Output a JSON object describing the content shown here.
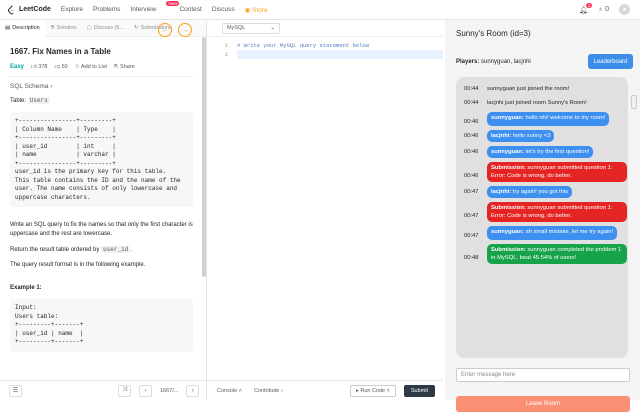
{
  "nav": {
    "brand": "LeetCode",
    "links": [
      "Explore",
      "Problems",
      "Interview",
      "Contest",
      "Discuss"
    ],
    "new_badge": "New",
    "store": "Store",
    "notif_count": "1",
    "coins": "0"
  },
  "left_tabs": [
    "Description",
    "Solution",
    "Discuss (5...",
    "Submissions"
  ],
  "problem": {
    "title": "1667. Fix Names in a Table",
    "difficulty": "Easy",
    "likes": "378",
    "dislikes": "60",
    "add_to_list": "Add to List",
    "share": "Share",
    "schema": "SQL Schema",
    "table_label": "Table:",
    "table_name": "Users",
    "schema_block": "+----------------+---------+\n| Column Name    | Type    |\n+----------------+---------+\n| user_id        | int     |\n| name           | varchar |\n+----------------+---------+\nuser_id is the primary key for this table.\nThis table contains the ID and the name of the\nuser. The name consists of only lowercase and\nuppercase characters.",
    "para1": "Write an SQL query to fix the names so that only the first character is uppercase and the rest are lowercase.",
    "para2_prefix": "Return the result table ordered by",
    "para2_code": "user_id",
    "para3": "The query result format is in the following example.",
    "example_title": "Example 1:",
    "example_block": "Input:\nUsers table:\n+---------+-------+\n| user_id | name  |\n+---------+-------+"
  },
  "bottom_left": {
    "page": "1667/..."
  },
  "editor": {
    "language": "MySQL",
    "lines": [
      "1",
      "2"
    ],
    "code_line1": "# Write your MySQL query statement below",
    "console": "Console",
    "contribute": "Contribute",
    "run": "Run Code",
    "submit": "Submit"
  },
  "room": {
    "title": "Sunny's Room (id=3)",
    "players_label": "Players:",
    "players": "sunnyguan, lacjnhi",
    "leaderboard": "Leaderboard",
    "messages": [
      {
        "time": "00:44",
        "kind": "system",
        "text": "sunnyguan just joined the room!"
      },
      {
        "time": "00:44",
        "kind": "system",
        "text": "lacjnhi just joined room Sunny's Room!"
      },
      {
        "time": "00:46",
        "kind": "blue",
        "user": "sunnyguan:",
        "text": " hello nhi! welcome to my room!"
      },
      {
        "time": "00:46",
        "kind": "blue",
        "user": "lacjnhi:",
        "text": " hello sunny <3"
      },
      {
        "time": "00:46",
        "kind": "blue",
        "user": "sunnyguan:",
        "text": " let's try the first question!"
      },
      {
        "time": "00:46",
        "kind": "red",
        "user": "Submission:",
        "text": " sunnyguan submitted question 1: Error: Code is wrong, do better."
      },
      {
        "time": "00:47",
        "kind": "blue",
        "user": "lacjnhi:",
        "text": " try again! you got this"
      },
      {
        "time": "00:47",
        "kind": "red",
        "user": "Submission:",
        "text": " sunnyguan submitted question 1: Error: Code is wrong, do better."
      },
      {
        "time": "00:47",
        "kind": "blue",
        "user": "sunnyguan:",
        "text": " ah small mistake, let me try again!"
      },
      {
        "time": "00:48",
        "kind": "green",
        "user": "Submission:",
        "text": " sunnyguan completed the problem 1 in MySQL, beat 45.54% of users!"
      }
    ],
    "input_placeholder": "Enter message here",
    "leave": "Leave Room"
  }
}
